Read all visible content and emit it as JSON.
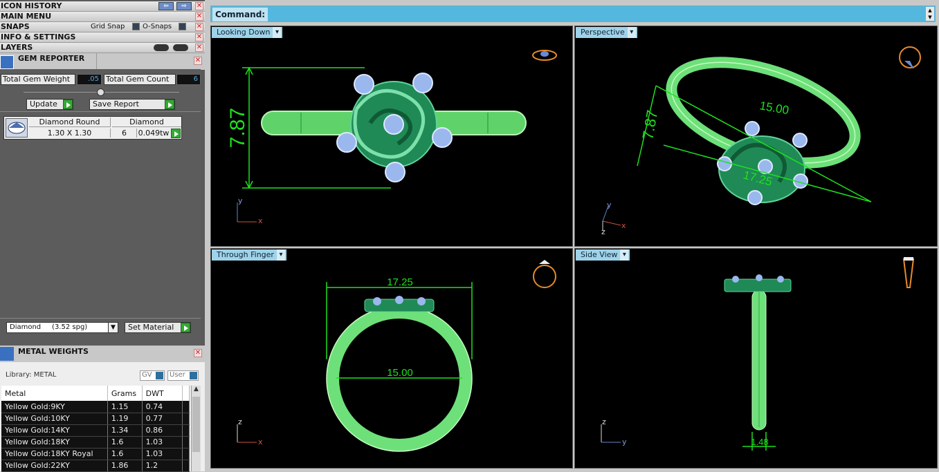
{
  "left_panel": {
    "headers": [
      "ICON HISTORY",
      "MAIN MENU",
      "SNAPS",
      "INFO & SETTINGS",
      "LAYERS"
    ],
    "snaps": {
      "grid_snap": "Grid Snap",
      "o_snaps": "O-Snaps"
    },
    "gem_reporter": {
      "title": "GEM REPORTER",
      "total_gem_weight_label": "Total Gem Weight",
      "total_gem_weight": ".05",
      "total_gem_count_label": "Total Gem Count",
      "total_gem_count": "6",
      "update_label": "Update",
      "save_report_label": "Save Report",
      "gem": {
        "shape": "Diamond Round",
        "size": "1.30 X 1.30",
        "material": "Diamond",
        "count": "6",
        "weight": "0.049tw"
      },
      "material_select": "Diamond     (3.52 spg)",
      "set_material_label": "Set Material"
    },
    "metal_weights": {
      "title": "METAL WEIGHTS",
      "library": "Library: METAL",
      "gv_label": "GV",
      "user_label": "User",
      "columns": [
        "Metal",
        "Grams",
        "DWT"
      ],
      "rows": [
        [
          "Yellow Gold:9KY",
          "1.15",
          "0.74"
        ],
        [
          "Yellow Gold:10KY",
          "1.19",
          "0.77"
        ],
        [
          "Yellow Gold:14KY",
          "1.34",
          "0.86"
        ],
        [
          "Yellow Gold:18KY",
          "1.6",
          "1.03"
        ],
        [
          "Yellow Gold:18KY Royal",
          "1.6",
          "1.03"
        ],
        [
          "Yellow Gold:22KY",
          "1.86",
          "1.2"
        ]
      ]
    }
  },
  "command": {
    "label": "Command:",
    "value": ""
  },
  "viewports": [
    {
      "name": "Looking Down",
      "dimension": "7.87",
      "axes": [
        "y",
        "x"
      ]
    },
    {
      "name": "Perspective",
      "dimensions": [
        "15.00",
        "7.87",
        "17.25"
      ],
      "axes": [
        "y",
        "z",
        "x"
      ]
    },
    {
      "name": "Through Finger",
      "dimensions": [
        "17.25",
        "15.00"
      ],
      "axes": [
        "z",
        "x"
      ]
    },
    {
      "name": "Side View",
      "dimension": "1.48",
      "axes": [
        "z",
        "y"
      ]
    }
  ]
}
